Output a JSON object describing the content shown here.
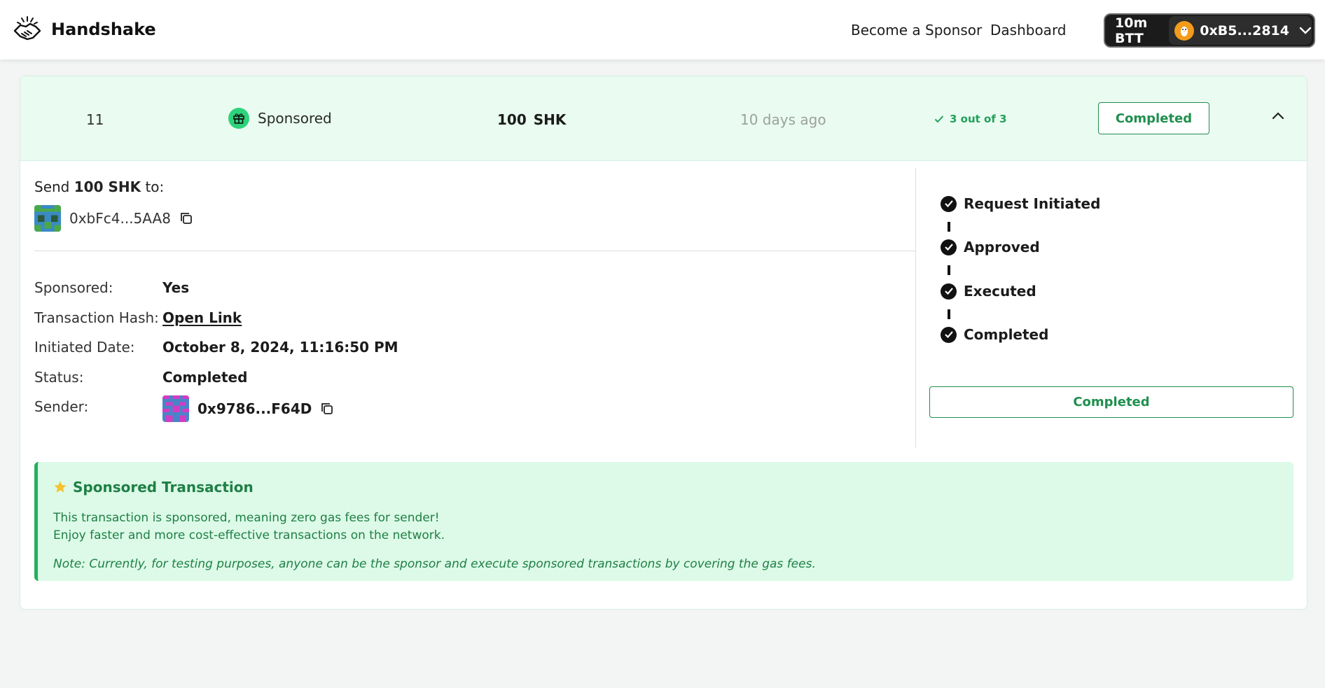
{
  "header": {
    "app_name": "Handshake",
    "nav": [
      "Become a Sponsor",
      "Dashboard"
    ],
    "wallet_balance": "10m BTT",
    "wallet_address": "0xB5...2814"
  },
  "request": {
    "id": "11",
    "type": "Sponsored",
    "amount": "100",
    "unit": "SHK",
    "time_ago": "10 days ago",
    "steps_label": "3 out of 3",
    "status": "Completed"
  },
  "details": {
    "send_prefix": "Send",
    "send_amount": "100 SHK",
    "send_suffix": "to:",
    "recipient": "0xbFc4...5AA8",
    "labels": {
      "sponsored": "Sponsored:",
      "tx_hash": "Transaction Hash:",
      "initiated": "Initiated Date:",
      "status": "Status:",
      "sender": "Sender:"
    },
    "values": {
      "sponsored": "Yes",
      "tx_hash": "Open Link",
      "initiated": "October 8, 2024, 11:16:50 PM",
      "status": "Completed",
      "sender": "0x9786...F64D"
    }
  },
  "stepper": {
    "steps": [
      "Request Initiated",
      "Approved",
      "Executed",
      "Completed"
    ],
    "button": "Completed"
  },
  "banner": {
    "title": "Sponsored Transaction",
    "line1": "This transaction is sponsored, meaning zero gas fees for sender!",
    "line2": "Enjoy faster and more cost-effective transactions on the network.",
    "note": "Note: Currently, for testing purposes, anyone can be the sponsor and execute sponsored transactions by covering the gas fees."
  },
  "colors": {
    "accent_green": "#1f8f4e",
    "header_bg": "#eafbf1",
    "banner_bg": "#dcfae7",
    "wallet_bg": "#1b1b1b"
  }
}
